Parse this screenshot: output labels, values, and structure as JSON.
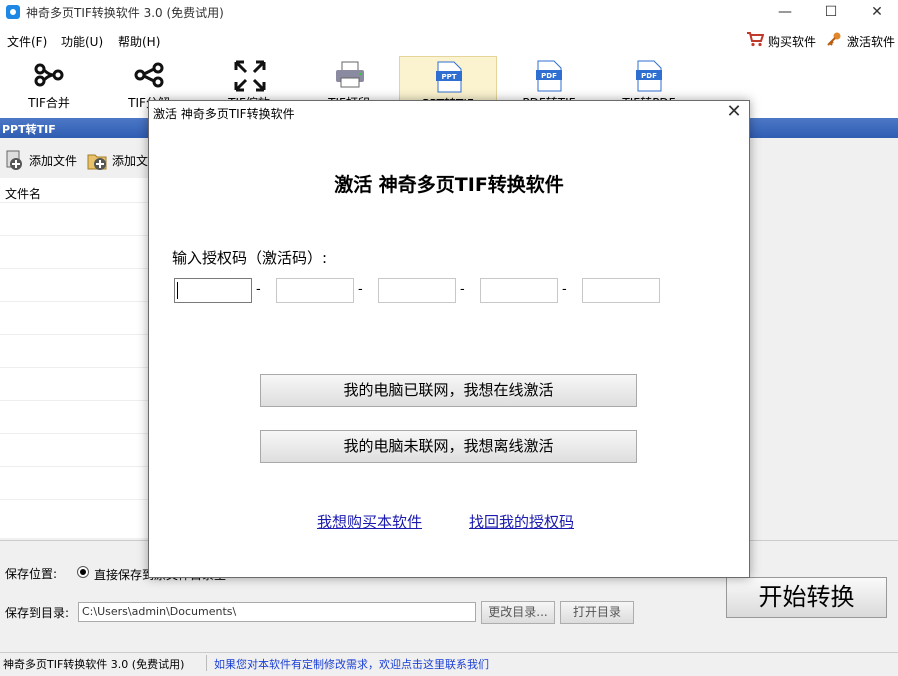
{
  "window": {
    "title": "神奇多页TIF转换软件 3.0 (免费试用)",
    "minimize": "—",
    "maximize": "☐",
    "close": "✕"
  },
  "menu": {
    "items": [
      "文件(F)",
      "功能(U)",
      "帮助(H)"
    ],
    "buy": "购买软件",
    "activate": "激活软件"
  },
  "toolbar": {
    "tools": [
      {
        "label": "TIF合并",
        "icon": "merge-icon"
      },
      {
        "label": "TIF分解",
        "icon": "split-icon"
      },
      {
        "label": "TIF缩放",
        "icon": "resize-icon"
      },
      {
        "label": "TIF打印",
        "icon": "printer-icon"
      },
      {
        "label": "PPT转TIF",
        "icon": "ppt-file-icon",
        "active": true
      },
      {
        "label": "PDF转TIF",
        "icon": "pdf-file-icon"
      },
      {
        "label": "TIF转PDF",
        "icon": "pdf-file-icon"
      }
    ]
  },
  "section": {
    "title": "PPT转TIF",
    "add_file": "添加文件",
    "add_folder": "添加文件夹",
    "column_filename": "文件名"
  },
  "bottom": {
    "save_location_label": "保存位置:",
    "option_direct": "直接保存到原文件目录里",
    "save_dir_label": "保存到目录:",
    "save_dir_value": "C:\\Users\\admin\\Documents\\",
    "change_dir": "更改目录...",
    "open_dir": "打开目录",
    "start": "开始转换"
  },
  "status": {
    "left": "神奇多页TIF转换软件 3.0 (免费试用)",
    "link": "如果您对本软件有定制修改需求，欢迎点击这里联系我们"
  },
  "dialog": {
    "title": "激活 神奇多页TIF转换软件",
    "close": "✕",
    "heading": "激活 神奇多页TIF转换软件",
    "prompt": "输入授权码（激活码）:",
    "dash": "-",
    "online_button": "我的电脑已联网，我想在线激活",
    "offline_button": "我的电脑未联网，我想离线激活",
    "buy_link": "我想购买本软件",
    "recover_link": "找回我的授权码"
  },
  "colors": {
    "section_header": "#3a66bb",
    "link": "#1a1ab0",
    "active_tool_bg": "#fbf3cf"
  }
}
